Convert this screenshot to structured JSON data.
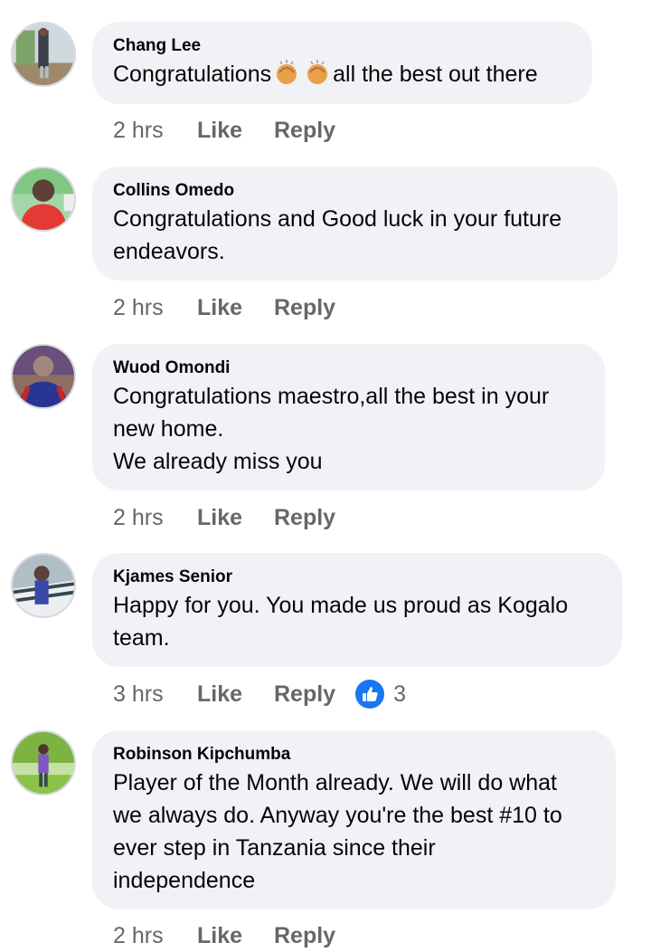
{
  "comments": [
    {
      "author": "Chang Lee",
      "text_before": "Congratulations",
      "emoji": "clapping-hands",
      "emoji_count": 2,
      "text_after": "all the best out there",
      "time": "2 hrs",
      "like": "Like",
      "reply": "Reply"
    },
    {
      "author": "Collins Omedo",
      "lines": [
        "Congratulations and Good luck in your future",
        "endeavors."
      ],
      "time": "2 hrs",
      "like": "Like",
      "reply": "Reply"
    },
    {
      "author": "Wuod Omondi",
      "lines": [
        "Congratulations maestro,all the best in your",
        "new home.",
        "We already miss you"
      ],
      "time": "2 hrs",
      "like": "Like",
      "reply": "Reply"
    },
    {
      "author": "Kjames Senior",
      "lines": [
        "Happy for you. You made us proud as Kogalo",
        "team."
      ],
      "time": "3 hrs",
      "like": "Like",
      "reply": "Reply",
      "reaction_icon": "thumbs-up-icon",
      "reaction_count": "3"
    },
    {
      "author": "Robinson Kipchumba",
      "lines": [
        "Player of the Month already. We will do what",
        "we always do. Anyway you're the best #10 to",
        "ever step in Tanzania since their",
        "independence"
      ],
      "time": "2 hrs",
      "like": "Like",
      "reply": "Reply"
    }
  ],
  "colors": {
    "bubble": "#f0f2f5",
    "meta_text": "#65676b",
    "like_blue": "#1877f2"
  }
}
